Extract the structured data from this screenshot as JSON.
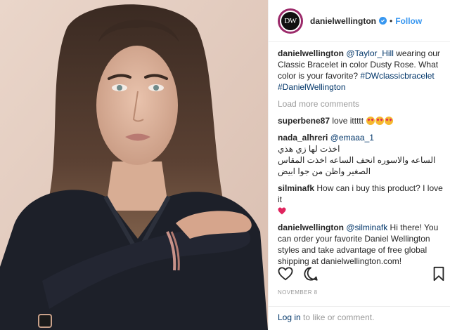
{
  "post": {
    "username": "danielwellington",
    "avatar_text": "DW",
    "follow_label": "Follow",
    "separator": "•",
    "caption": {
      "username": "danielwellington",
      "mention": "@Taylor_Hill",
      "text": " wearing our Classic Bracelet in color Dusty Rose. What color is your favorite? ",
      "hashtag1": "#DWclassicbracelet",
      "hashtag2": "#DanielWellington"
    },
    "load_more": "Load more comments",
    "comments": [
      {
        "username": "superbene87",
        "text": "love ittttt"
      },
      {
        "username": "nada_alhreri",
        "mention": "@emaaa_1",
        "text": "اخذت لها زي هذي\nالساعه والاسوره انحف الساعه اخذت المقاس\nالصغير واظن من جوا ابيض"
      },
      {
        "username": "silminafk",
        "text": "How can i buy this product? I love it"
      },
      {
        "username": "danielwellington",
        "mention": "@silminafk",
        "text": " Hi there! You can order your favorite Daniel Wellington styles and take advantage of free global shipping at danielwellington.com!"
      }
    ],
    "date": "NOVEMBER 8",
    "login_link": "Log in",
    "login_text": " to like or comment."
  },
  "icons": {
    "verified": "verified-badge-icon",
    "like": "heart-outline-icon",
    "comment": "comment-bubble-icon",
    "save": "bookmark-icon",
    "heart_emoji": "red-heart-emoji",
    "star_eyes": "star-struck-emoji"
  },
  "colors": {
    "link": "#003569",
    "accent": "#3897f0",
    "muted": "#999999",
    "text": "#262626"
  }
}
